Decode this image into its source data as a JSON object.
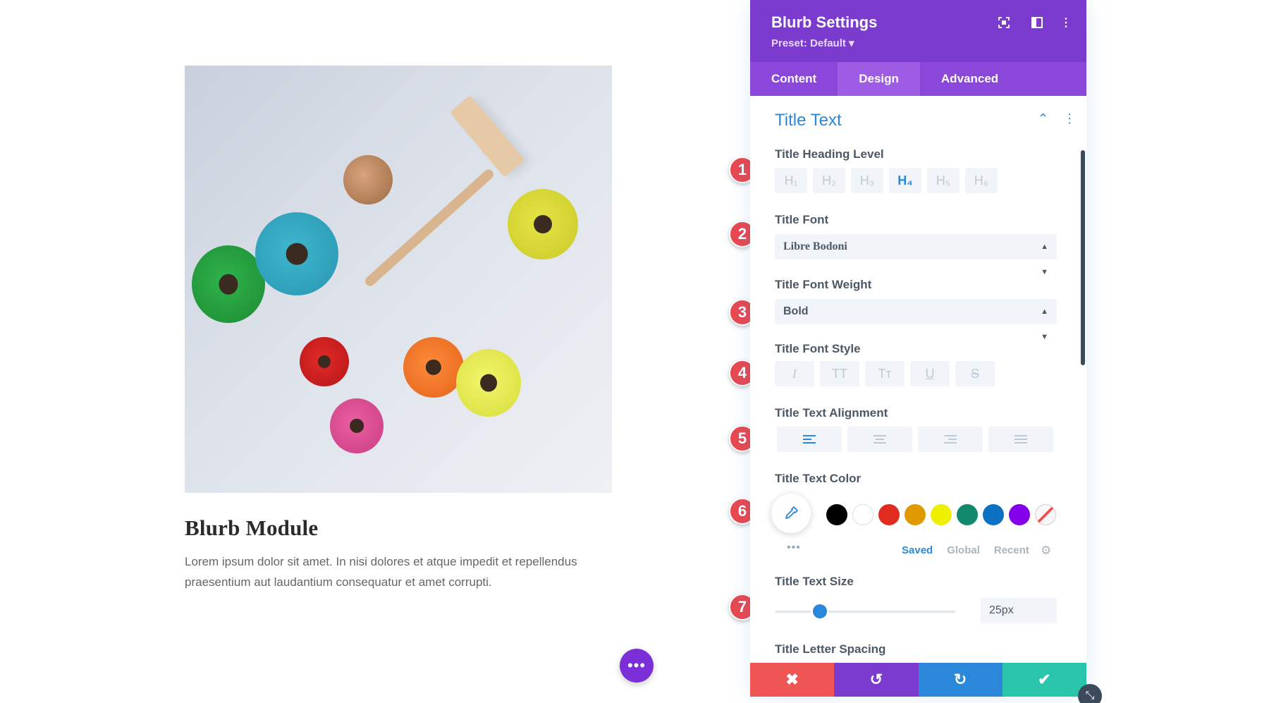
{
  "preview": {
    "title": "Blurb Module",
    "body": "Lorem ipsum dolor sit amet. In nisi dolores et atque impedit et repellendus praesentium aut laudantium consequatur et amet corrupti.",
    "fab_label": "•••"
  },
  "panel": {
    "title": "Blurb Settings",
    "preset": "Preset: Default ▾",
    "tabs": [
      "Content",
      "Design",
      "Advanced"
    ],
    "active_tab": "Design",
    "section_title": "Title Text",
    "heading_level": {
      "label": "Title Heading Level",
      "options": [
        "H₁",
        "H₂",
        "H₃",
        "H₄",
        "H₅",
        "H₆"
      ],
      "selected": "H₄"
    },
    "font": {
      "label": "Title Font",
      "value": "Libre Bodoni"
    },
    "weight": {
      "label": "Title Font Weight",
      "value": "Bold"
    },
    "style": {
      "label": "Title Font Style",
      "options": [
        "I",
        "TT",
        "Tт",
        "U",
        "S"
      ]
    },
    "alignment": {
      "label": "Title Text Alignment",
      "selected": "left"
    },
    "color": {
      "label": "Title Text Color",
      "swatches": [
        "#000000",
        "#ffffff",
        "#e02b20",
        "#e09900",
        "#edf000",
        "#12886d",
        "#0c71c3",
        "#8300e9"
      ],
      "tabs": [
        "Saved",
        "Global",
        "Recent"
      ],
      "active_tab": "Saved",
      "more": "•••"
    },
    "size": {
      "label": "Title Text Size",
      "value": "25px",
      "slider_fraction": 0.25
    },
    "letter_spacing": {
      "label": "Title Letter Spacing"
    }
  },
  "callouts": [
    "1",
    "2",
    "3",
    "4",
    "5",
    "6",
    "7"
  ],
  "colors": {
    "header": "#7c3bcf",
    "tabs": "#8a47d9",
    "accent": "#2b87da",
    "cancel": "#ef5555",
    "undo": "#7c3bcf",
    "redo": "#2b87da",
    "save": "#29c4a9"
  }
}
